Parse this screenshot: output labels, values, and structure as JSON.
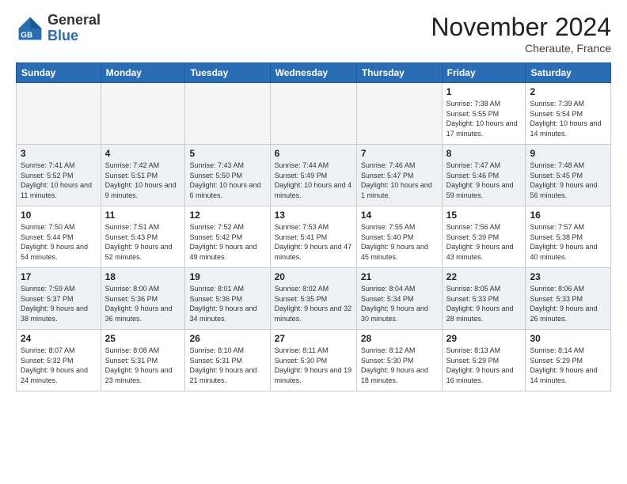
{
  "header": {
    "logo_general": "General",
    "logo_blue": "Blue",
    "month_title": "November 2024",
    "location": "Cheraute, France"
  },
  "days_of_week": [
    "Sunday",
    "Monday",
    "Tuesday",
    "Wednesday",
    "Thursday",
    "Friday",
    "Saturday"
  ],
  "weeks": [
    [
      {
        "day": "",
        "info": "",
        "empty": true
      },
      {
        "day": "",
        "info": "",
        "empty": true
      },
      {
        "day": "",
        "info": "",
        "empty": true
      },
      {
        "day": "",
        "info": "",
        "empty": true
      },
      {
        "day": "",
        "info": "",
        "empty": true
      },
      {
        "day": "1",
        "info": "Sunrise: 7:38 AM\nSunset: 5:55 PM\nDaylight: 10 hours and 17 minutes."
      },
      {
        "day": "2",
        "info": "Sunrise: 7:39 AM\nSunset: 5:54 PM\nDaylight: 10 hours and 14 minutes."
      }
    ],
    [
      {
        "day": "3",
        "info": "Sunrise: 7:41 AM\nSunset: 5:52 PM\nDaylight: 10 hours and 11 minutes."
      },
      {
        "day": "4",
        "info": "Sunrise: 7:42 AM\nSunset: 5:51 PM\nDaylight: 10 hours and 9 minutes."
      },
      {
        "day": "5",
        "info": "Sunrise: 7:43 AM\nSunset: 5:50 PM\nDaylight: 10 hours and 6 minutes."
      },
      {
        "day": "6",
        "info": "Sunrise: 7:44 AM\nSunset: 5:49 PM\nDaylight: 10 hours and 4 minutes."
      },
      {
        "day": "7",
        "info": "Sunrise: 7:46 AM\nSunset: 5:47 PM\nDaylight: 10 hours and 1 minute."
      },
      {
        "day": "8",
        "info": "Sunrise: 7:47 AM\nSunset: 5:46 PM\nDaylight: 9 hours and 59 minutes."
      },
      {
        "day": "9",
        "info": "Sunrise: 7:48 AM\nSunset: 5:45 PM\nDaylight: 9 hours and 56 minutes."
      }
    ],
    [
      {
        "day": "10",
        "info": "Sunrise: 7:50 AM\nSunset: 5:44 PM\nDaylight: 9 hours and 54 minutes."
      },
      {
        "day": "11",
        "info": "Sunrise: 7:51 AM\nSunset: 5:43 PM\nDaylight: 9 hours and 52 minutes."
      },
      {
        "day": "12",
        "info": "Sunrise: 7:52 AM\nSunset: 5:42 PM\nDaylight: 9 hours and 49 minutes."
      },
      {
        "day": "13",
        "info": "Sunrise: 7:53 AM\nSunset: 5:41 PM\nDaylight: 9 hours and 47 minutes."
      },
      {
        "day": "14",
        "info": "Sunrise: 7:55 AM\nSunset: 5:40 PM\nDaylight: 9 hours and 45 minutes."
      },
      {
        "day": "15",
        "info": "Sunrise: 7:56 AM\nSunset: 5:39 PM\nDaylight: 9 hours and 43 minutes."
      },
      {
        "day": "16",
        "info": "Sunrise: 7:57 AM\nSunset: 5:38 PM\nDaylight: 9 hours and 40 minutes."
      }
    ],
    [
      {
        "day": "17",
        "info": "Sunrise: 7:59 AM\nSunset: 5:37 PM\nDaylight: 9 hours and 38 minutes."
      },
      {
        "day": "18",
        "info": "Sunrise: 8:00 AM\nSunset: 5:36 PM\nDaylight: 9 hours and 36 minutes."
      },
      {
        "day": "19",
        "info": "Sunrise: 8:01 AM\nSunset: 5:36 PM\nDaylight: 9 hours and 34 minutes."
      },
      {
        "day": "20",
        "info": "Sunrise: 8:02 AM\nSunset: 5:35 PM\nDaylight: 9 hours and 32 minutes."
      },
      {
        "day": "21",
        "info": "Sunrise: 8:04 AM\nSunset: 5:34 PM\nDaylight: 9 hours and 30 minutes."
      },
      {
        "day": "22",
        "info": "Sunrise: 8:05 AM\nSunset: 5:33 PM\nDaylight: 9 hours and 28 minutes."
      },
      {
        "day": "23",
        "info": "Sunrise: 8:06 AM\nSunset: 5:33 PM\nDaylight: 9 hours and 26 minutes."
      }
    ],
    [
      {
        "day": "24",
        "info": "Sunrise: 8:07 AM\nSunset: 5:32 PM\nDaylight: 9 hours and 24 minutes."
      },
      {
        "day": "25",
        "info": "Sunrise: 8:08 AM\nSunset: 5:31 PM\nDaylight: 9 hours and 23 minutes."
      },
      {
        "day": "26",
        "info": "Sunrise: 8:10 AM\nSunset: 5:31 PM\nDaylight: 9 hours and 21 minutes."
      },
      {
        "day": "27",
        "info": "Sunrise: 8:11 AM\nSunset: 5:30 PM\nDaylight: 9 hours and 19 minutes."
      },
      {
        "day": "28",
        "info": "Sunrise: 8:12 AM\nSunset: 5:30 PM\nDaylight: 9 hours and 18 minutes."
      },
      {
        "day": "29",
        "info": "Sunrise: 8:13 AM\nSunset: 5:29 PM\nDaylight: 9 hours and 16 minutes."
      },
      {
        "day": "30",
        "info": "Sunrise: 8:14 AM\nSunset: 5:29 PM\nDaylight: 9 hours and 14 minutes."
      }
    ]
  ]
}
